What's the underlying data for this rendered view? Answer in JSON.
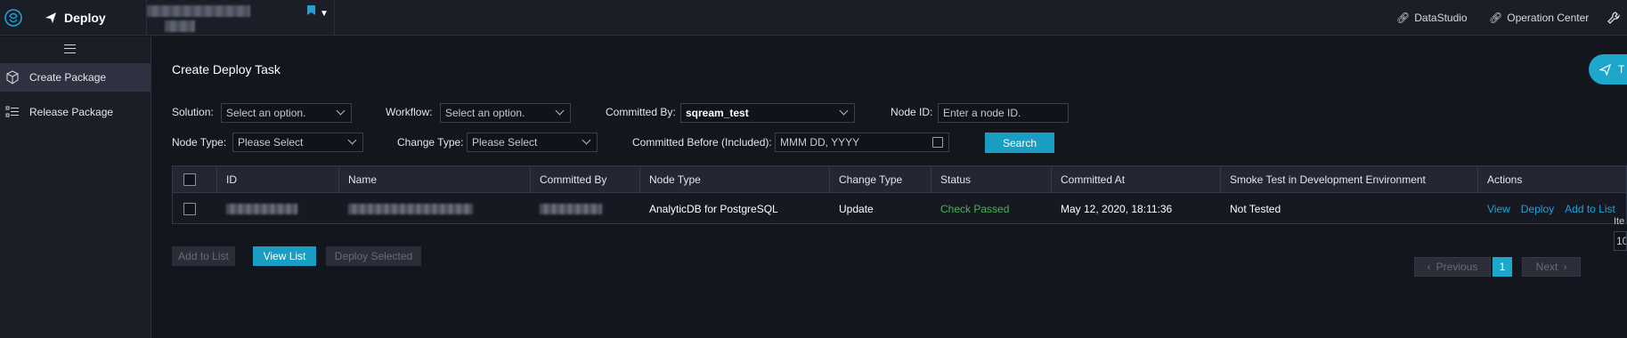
{
  "app": {
    "title": "Deploy"
  },
  "topbar": {
    "links": [
      {
        "label": "DataStudio",
        "icon": "link-icon"
      },
      {
        "label": "Operation Center",
        "icon": "link-icon"
      }
    ]
  },
  "sidebar": {
    "items": [
      {
        "label": "Create Package",
        "icon": "package-icon",
        "active": true
      },
      {
        "label": "Release Package",
        "icon": "list-icon",
        "active": false
      }
    ]
  },
  "page": {
    "title": "Create Deploy Task",
    "floating_button_label": "T"
  },
  "filters": {
    "solution": {
      "label": "Solution:",
      "placeholder": "Select an option."
    },
    "workflow": {
      "label": "Workflow:",
      "placeholder": "Select an option."
    },
    "committed_by": {
      "label": "Committed By:",
      "value": "sqream_test"
    },
    "node_id": {
      "label": "Node ID:",
      "placeholder": "Enter a node ID."
    },
    "node_type": {
      "label": "Node Type:",
      "placeholder": "Please Select"
    },
    "change_type": {
      "label": "Change Type:",
      "placeholder": "Please Select"
    },
    "committed_before": {
      "label": "Committed Before (Included):",
      "placeholder": "MMM DD, YYYY"
    },
    "search_label": "Search"
  },
  "table": {
    "headers": [
      "ID",
      "Name",
      "Committed By",
      "Node Type",
      "Change Type",
      "Status",
      "Committed At",
      "Smoke Test in Development Environment",
      "Actions"
    ],
    "rows": [
      {
        "node_type": "AnalyticDB for PostgreSQL",
        "change_type": "Update",
        "status": "Check Passed",
        "committed_at": "May 12, 2020, 18:11:36",
        "smoke_test": "Not Tested",
        "actions": [
          "View",
          "Deploy",
          "Add to List"
        ]
      }
    ]
  },
  "bottom_buttons": {
    "add_to_list": "Add to List",
    "view_list": "View List",
    "deploy_selected": "Deploy Selected"
  },
  "pagination": {
    "previous": "Previous",
    "current_page": "1",
    "next": "Next",
    "items_label": "Ite",
    "items_value": "10"
  },
  "colors": {
    "accent": "#1da7cc",
    "success": "#3fb950",
    "link": "#1fa3d7"
  }
}
